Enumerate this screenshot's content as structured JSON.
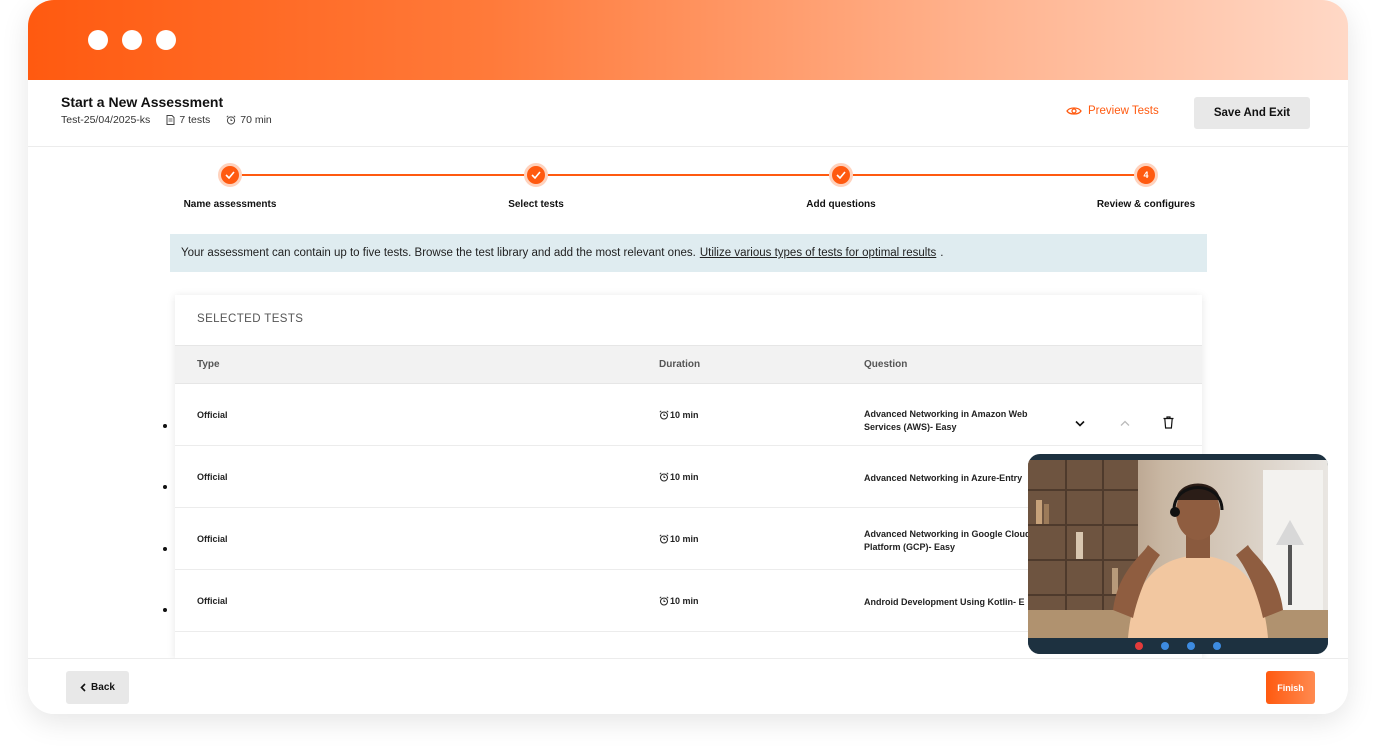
{
  "header": {
    "title": "Start a New Assessment",
    "assessment_id": "Test-25/04/2025-ks",
    "tests_count": "7 tests",
    "duration": "70 min",
    "preview_label": "Preview Tests",
    "save_label": "Save And Exit"
  },
  "stepper": {
    "steps": [
      {
        "label": "Name assessments",
        "state": "done"
      },
      {
        "label": "Select tests",
        "state": "done"
      },
      {
        "label": "Add questions",
        "state": "done"
      },
      {
        "label": "Review & configures",
        "state": "current",
        "number": "4"
      }
    ]
  },
  "banner": {
    "text": "Your assessment can contain up to five tests. Browse the test library and add the most relevant ones.",
    "link": "Utilize various types of tests for optimal results",
    "suffix": "."
  },
  "panel": {
    "title": "SELECTED TESTS",
    "columns": {
      "type": "Type",
      "duration": "Duration",
      "question": "Question"
    },
    "rows": [
      {
        "type": "Official",
        "duration": "10 min",
        "question": "Advanced Networking in Amazon Web Services (AWS)- Easy"
      },
      {
        "type": "Official",
        "duration": "10 min",
        "question": "Advanced Networking in Azure-Entry"
      },
      {
        "type": "Official",
        "duration": "10 min",
        "question": "Advanced Networking in Google Cloud Platform (GCP)- Easy"
      },
      {
        "type": "Official",
        "duration": "10 min",
        "question": "Android Development Using Kotlin- E"
      }
    ]
  },
  "footer": {
    "back_label": "Back",
    "finish_label": "Finish"
  },
  "colors": {
    "accent": "#ff5a10",
    "banner_bg": "#dfecf0",
    "button_gray": "#e8e8e8"
  },
  "icons": [
    "document-icon",
    "alarm-clock-icon",
    "eye-icon",
    "check-icon",
    "chevron-down-icon",
    "chevron-up-icon",
    "trash-icon",
    "chevron-left-icon"
  ]
}
